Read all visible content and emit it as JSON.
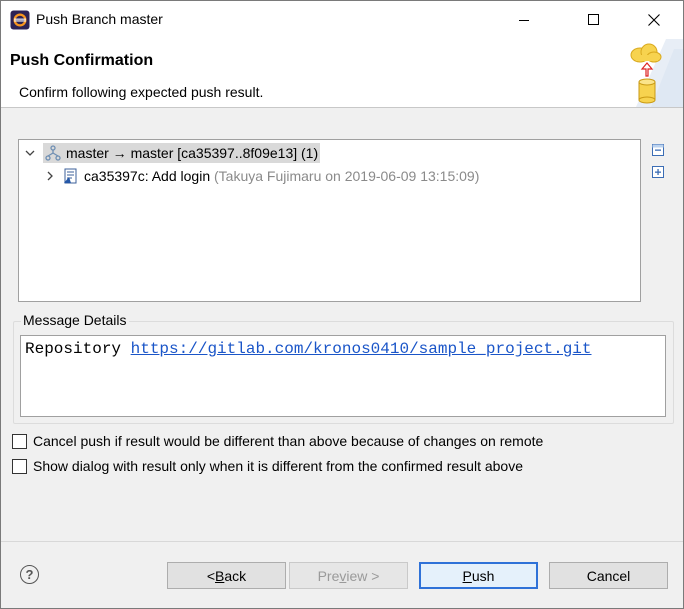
{
  "window": {
    "title": "Push Branch master",
    "icon": "eclipse-icon"
  },
  "header": {
    "title": "Push Confirmation",
    "description": "Confirm following expected push result."
  },
  "tree": {
    "rows": [
      {
        "label": "master → master [ca35397..8f09e13] (1)",
        "icon": "branch-icon",
        "expanded": true,
        "selected": true
      },
      {
        "label": "ca35397c: Add login",
        "detail": "(Takuya Fujimaru on 2019-06-09 13:15:09)",
        "icon": "commit-icon",
        "expanded": false
      }
    ]
  },
  "message_details": {
    "label": "Message Details",
    "repository_label": "Repository",
    "repository_url": "https://gitlab.com/kronos0410/sample_project.git"
  },
  "options": {
    "cancel_if_different": {
      "label": "Cancel push if result would be different than above because of changes on remote",
      "checked": false
    },
    "show_only_if_different": {
      "label": "Show dialog with result only when it is different from the confirmed result above",
      "checked": false
    }
  },
  "buttons": {
    "back_prefix": "< ",
    "back_mnemonic": "B",
    "back_rest": "ack",
    "preview_mnemonic": "Pre",
    "preview_u": "v",
    "preview_rest": "iew >",
    "push_mnemonic": "P",
    "push_rest": "ush",
    "cancel": "Cancel"
  },
  "colors": {
    "accent": "#2f72d8",
    "link": "#1a55c8"
  }
}
